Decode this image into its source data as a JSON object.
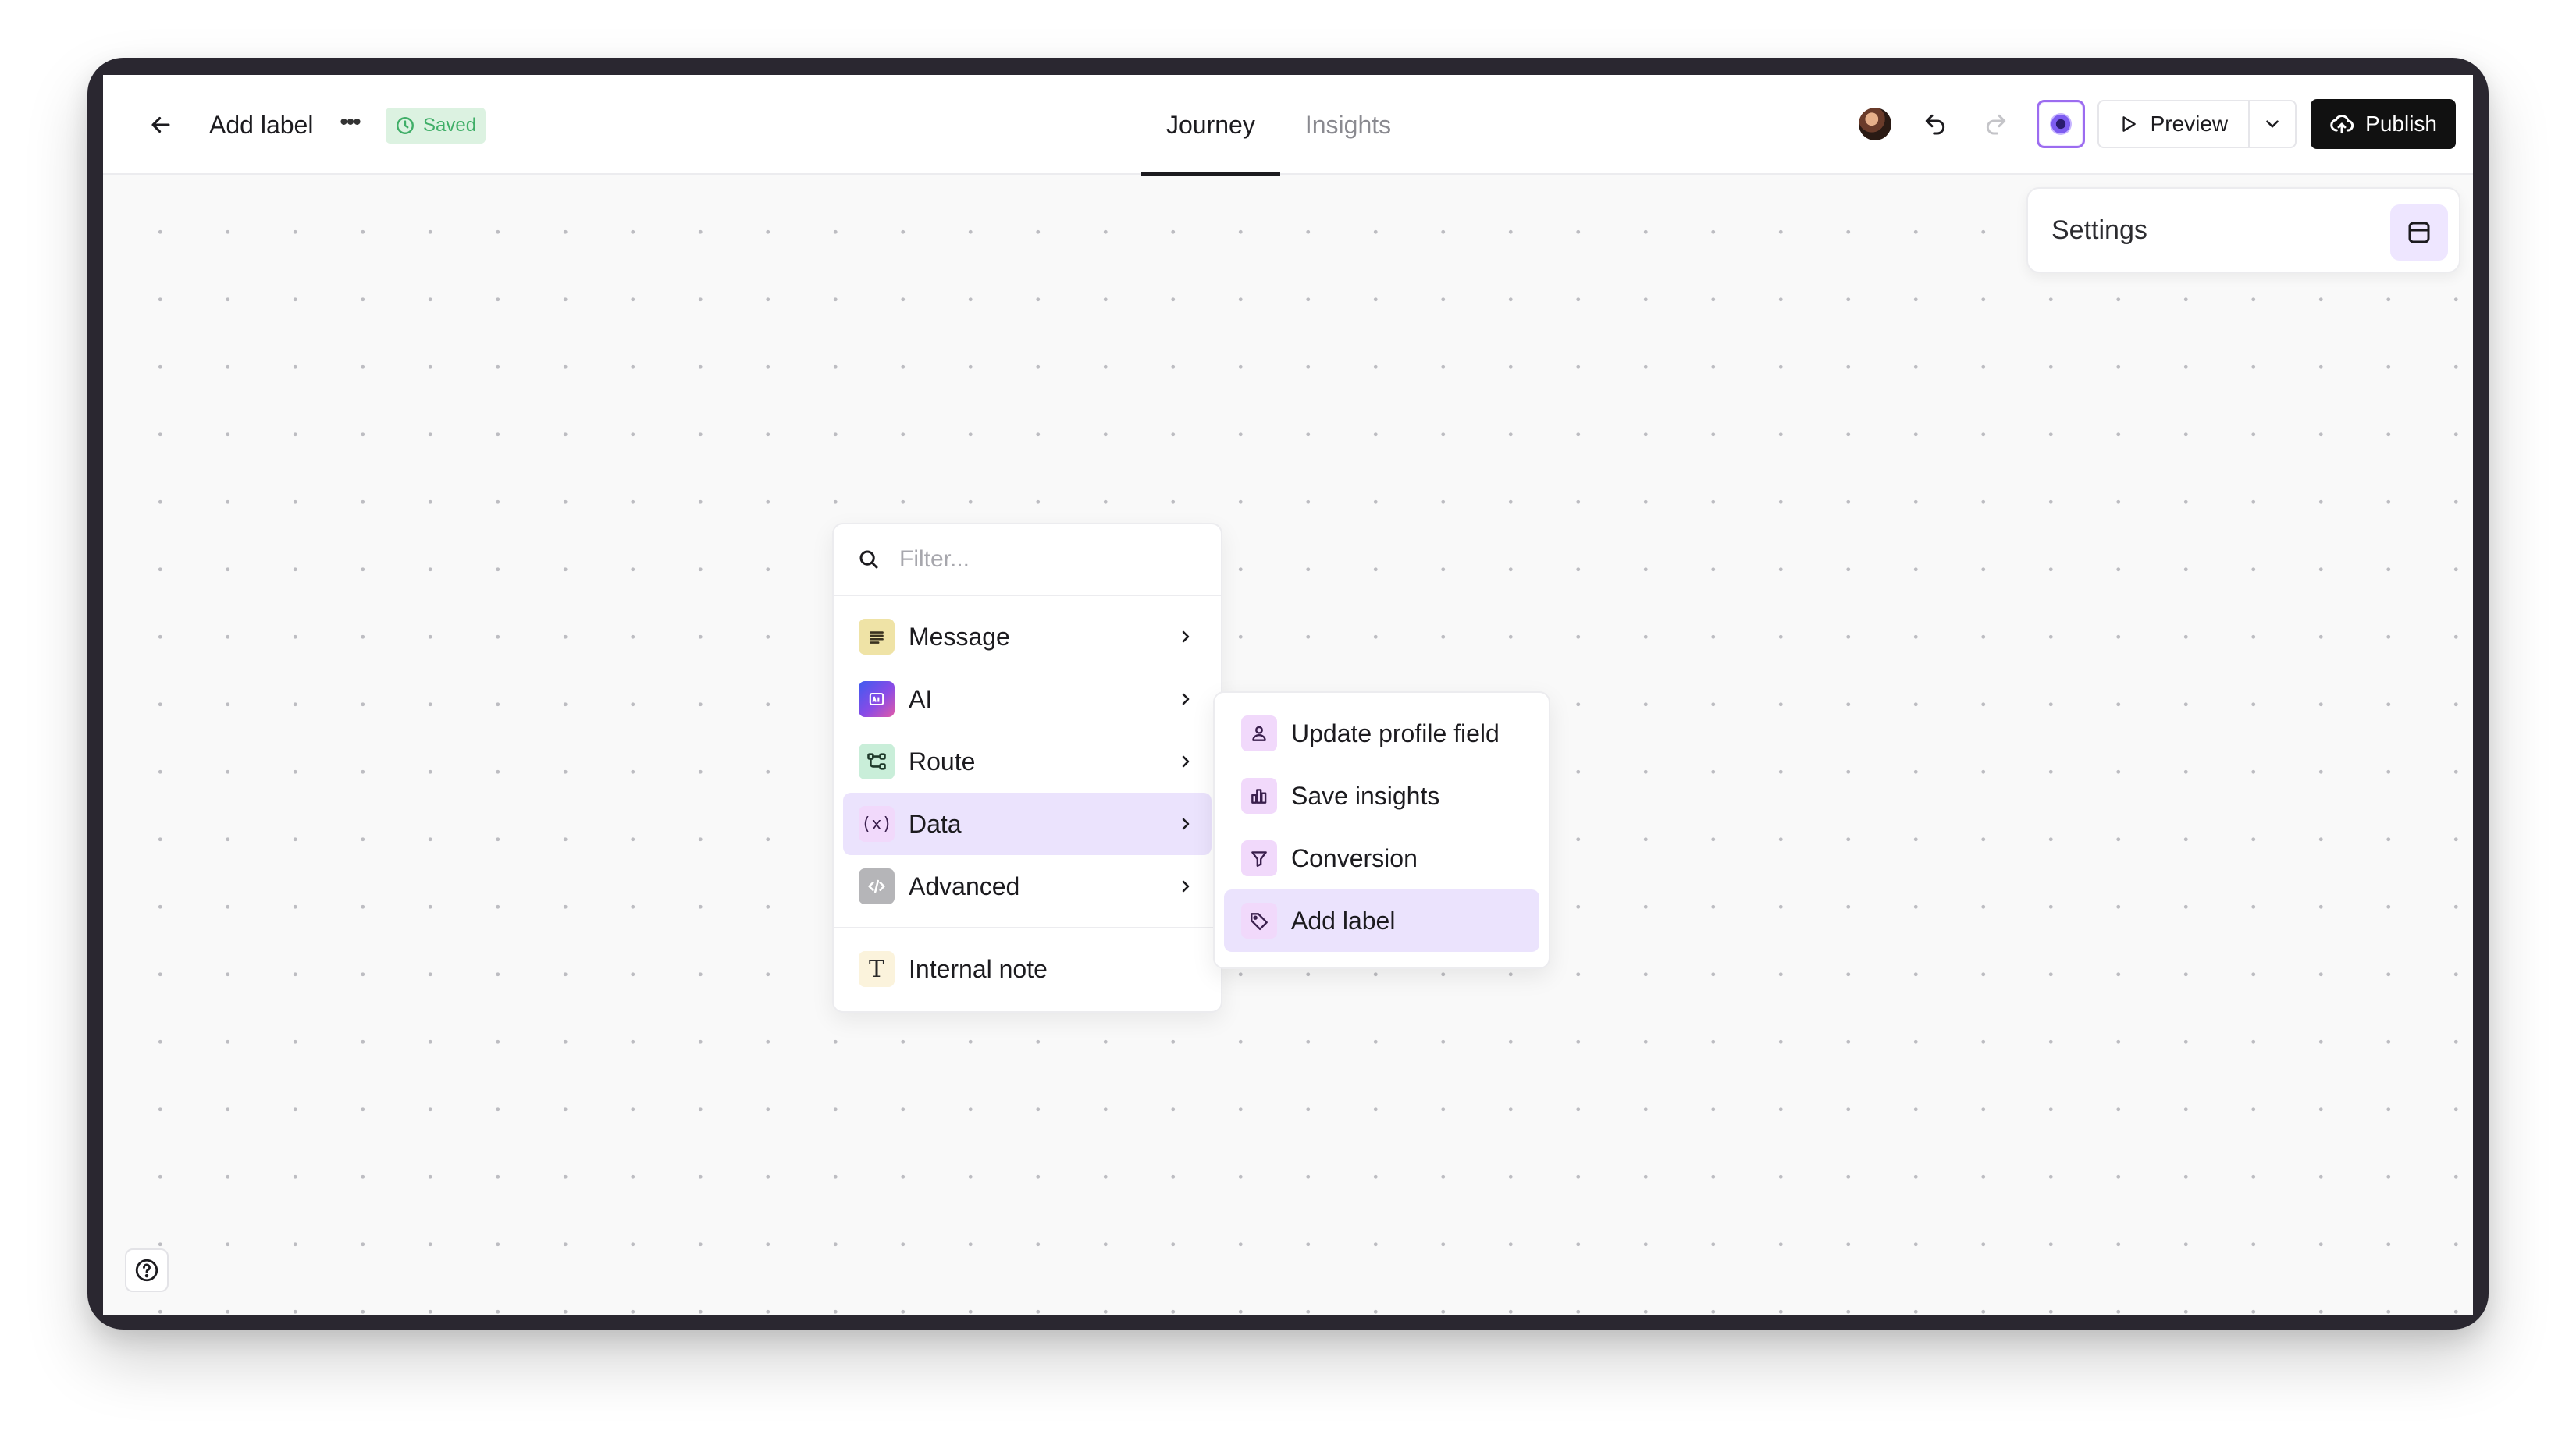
{
  "header": {
    "title": "Add label",
    "status": "Saved",
    "tabs": [
      {
        "label": "Journey",
        "active": true
      },
      {
        "label": "Insights",
        "active": false
      }
    ],
    "preview_label": "Preview",
    "publish_label": "Publish"
  },
  "settings": {
    "title": "Settings"
  },
  "menu": {
    "filter_placeholder": "Filter...",
    "items": [
      {
        "label": "Message",
        "icon": "message-lines-icon",
        "color": "#efe3a6"
      },
      {
        "label": "AI",
        "icon": "ai-icon",
        "color": "#6b4fe8"
      },
      {
        "label": "Route",
        "icon": "route-icon",
        "color": "#c9eed9"
      },
      {
        "label": "Data",
        "icon": "variable-icon",
        "color": "#f1d9fb"
      },
      {
        "label": "Advanced",
        "icon": "code-icon",
        "color": "#dadada"
      }
    ],
    "note_label": "Internal note",
    "active_item": "Data"
  },
  "submenu": {
    "items": [
      {
        "label": "Update profile field",
        "icon": "user-icon"
      },
      {
        "label": "Save insights",
        "icon": "chart-icon"
      },
      {
        "label": "Conversion",
        "icon": "funnel-icon"
      },
      {
        "label": "Add label",
        "icon": "tag-icon"
      }
    ],
    "active_item": "Add label"
  },
  "colors": {
    "accent": "#9c6cf0",
    "highlight": "#ebe3fd",
    "saved_green": "#3fae67",
    "publish_bg": "#111111"
  }
}
